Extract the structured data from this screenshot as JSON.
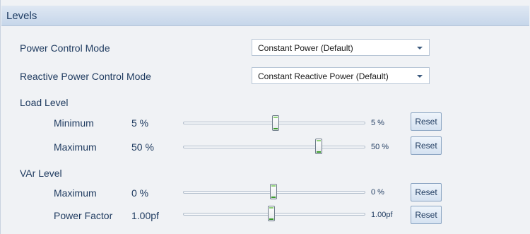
{
  "header": {
    "title": "Levels"
  },
  "power_control_mode": {
    "label": "Power Control Mode",
    "value": "Constant Power (Default)"
  },
  "reactive_power_control_mode": {
    "label": "Reactive Power Control Mode",
    "value": "Constant Reactive Power (Default)"
  },
  "load_level": {
    "title": "Load Level",
    "minimum": {
      "label": "Minimum",
      "value": "5 %",
      "slider_value": "5 %",
      "reset_label": "Reset",
      "slider_fraction": 0.49
    },
    "maximum": {
      "label": "Maximum",
      "value": "50 %",
      "slider_value": "50 %",
      "reset_label": "Reset",
      "slider_fraction": 0.73
    }
  },
  "var_level": {
    "title": "VAr Level",
    "maximum": {
      "label": "Maximum",
      "value": "0 %",
      "slider_value": "0 %",
      "reset_label": "Reset",
      "slider_fraction": 0.48
    },
    "power_factor": {
      "label": "Power Factor",
      "value": "1.00pf",
      "slider_value": "1.00pf",
      "reset_label": "Reset",
      "slider_fraction": 0.48
    }
  }
}
